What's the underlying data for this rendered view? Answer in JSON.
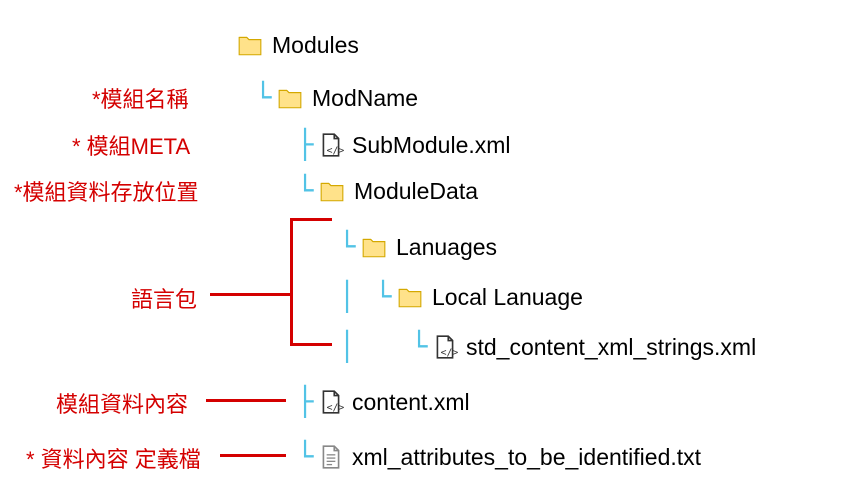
{
  "tree": {
    "root": "Modules",
    "modname": "ModName",
    "submodule": "SubModule.xml",
    "moduledata": "ModuleData",
    "languages": "Lanuages",
    "local_language": "Local Lanuage",
    "strings_file": "std_content_xml_strings.xml",
    "content_file": "content.xml",
    "attrs_file": "xml_attributes_to_be_identified.txt"
  },
  "annotations": {
    "modname": "*模組名稱",
    "meta": "* 模組META",
    "datapath": "*模組資料存放位置",
    "langpack": "語言包",
    "datacontent": "模組資料內容",
    "attrdefs": "* 資料內容 定義檔"
  }
}
